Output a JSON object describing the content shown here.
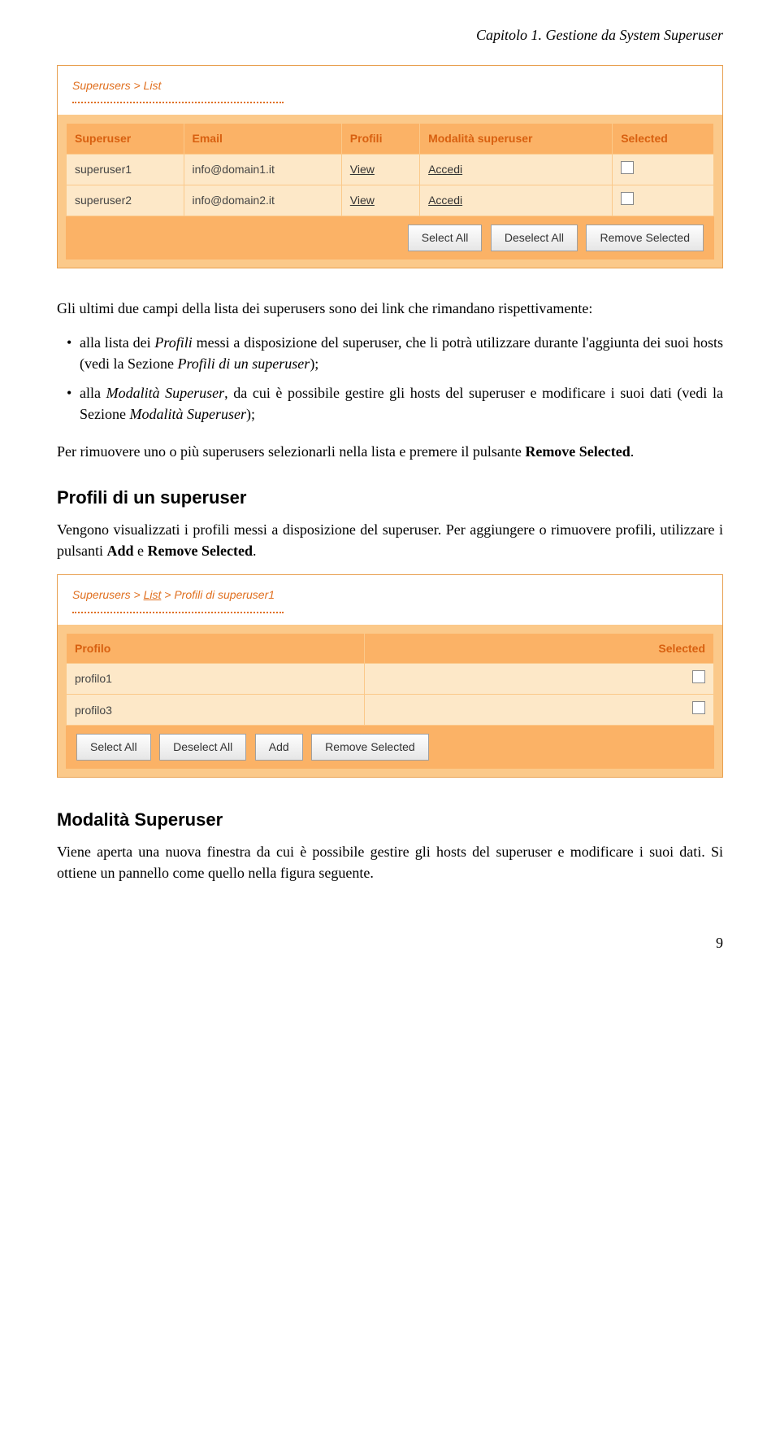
{
  "chapter_header": "Capitolo 1. Gestione da System Superuser",
  "panel1": {
    "breadcrumb_plain": "Superusers > List",
    "headers": [
      "Superuser",
      "Email",
      "Profili",
      "Modalità superuser",
      "Selected"
    ],
    "rows": [
      {
        "user": "superuser1",
        "email": "info@domain1.it",
        "profili": "View",
        "mode": "Accedi"
      },
      {
        "user": "superuser2",
        "email": "info@domain2.it",
        "profili": "View",
        "mode": "Accedi"
      }
    ],
    "buttons": {
      "select_all": "Select All",
      "deselect_all": "Deselect All",
      "remove_selected": "Remove Selected"
    }
  },
  "para_intro": "Gli ultimi due campi della lista dei superusers sono dei link che rimandano rispettivamente:",
  "bullets": {
    "b1_pre": "alla lista dei ",
    "b1_it1": "Profili",
    "b1_mid": " messi a disposizione del superuser, che li potrà utilizzare durante l'aggiunta dei suoi hosts (vedi la Sezione ",
    "b1_it2": "Profili di un superuser",
    "b1_post": ");",
    "b2_pre": "alla ",
    "b2_it1": "Modalità Superuser",
    "b2_mid": ", da cui è possibile gestire gli hosts del superuser e modificare i suoi dati (vedi la Sezione ",
    "b2_it2": "Modalità Superuser",
    "b2_post": ");"
  },
  "para_remove": "Per rimuovere uno o più superusers selezionarli nella lista e premere il pulsante ",
  "para_remove_bold": "Remove Selected",
  "section_profili": {
    "title": "Profili di un superuser",
    "body_a": "Vengono visualizzati i profili messi a disposizione del superuser. Per aggiungere o rimuovere profili, utilizzare i pulsanti ",
    "bold1": "Add",
    "body_b": " e ",
    "bold2": "Remove Selected",
    "body_c": "."
  },
  "panel2": {
    "crumb_a": "Superusers > ",
    "crumb_link": "List",
    "crumb_b": " > Profili di superuser1",
    "headers": [
      "Profilo",
      "Selected"
    ],
    "rows": [
      {
        "name": "profilo1"
      },
      {
        "name": "profilo3"
      }
    ],
    "buttons": {
      "select_all": "Select All",
      "deselect_all": "Deselect All",
      "add": "Add",
      "remove_selected": "Remove Selected"
    }
  },
  "section_modalita": {
    "title": "Modalità Superuser",
    "body": "Viene aperta una nuova finestra da cui è possibile gestire gli hosts del superuser e modificare i suoi dati. Si ottiene un pannello come quello nella figura seguente."
  },
  "page_number": "9"
}
